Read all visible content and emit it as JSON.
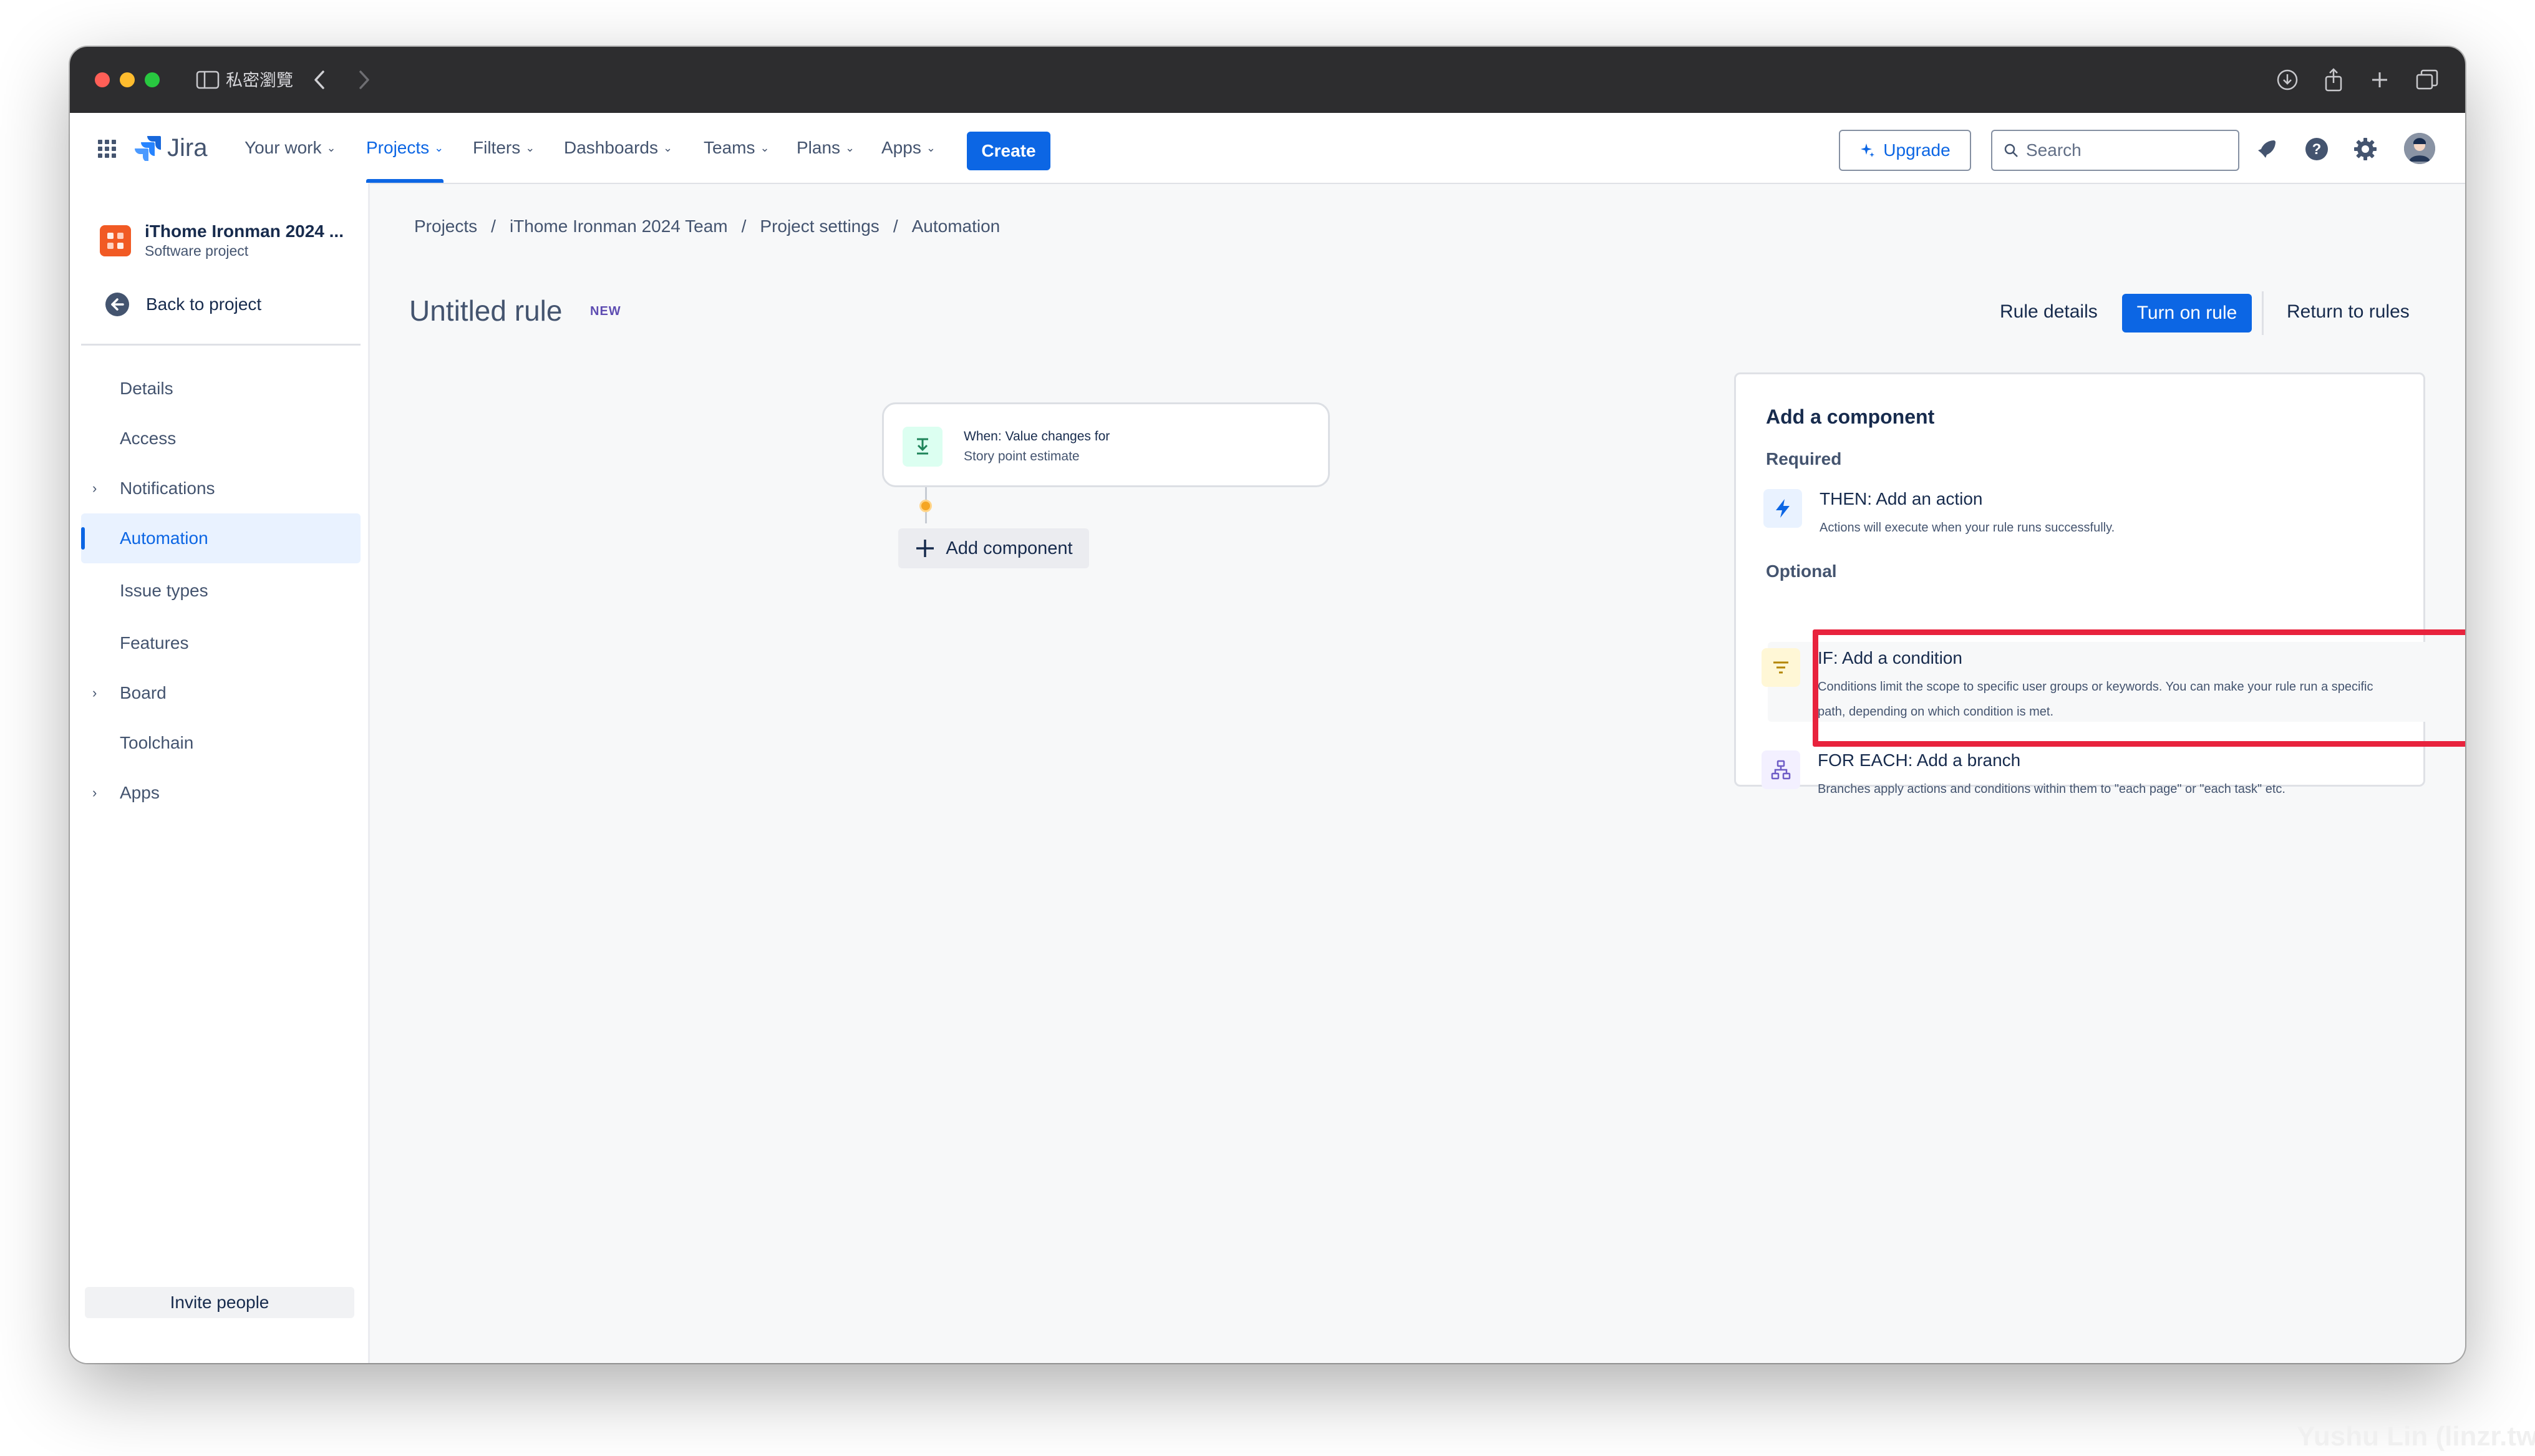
{
  "browser": {
    "tab_label": "私密瀏覽"
  },
  "header": {
    "logo_text": "Jira",
    "nav": [
      {
        "label": "Your work"
      },
      {
        "label": "Projects"
      },
      {
        "label": "Filters"
      },
      {
        "label": "Dashboards"
      },
      {
        "label": "Teams"
      },
      {
        "label": "Plans"
      },
      {
        "label": "Apps"
      }
    ],
    "create_label": "Create",
    "upgrade_label": "Upgrade",
    "search_placeholder": "Search"
  },
  "sidebar": {
    "project_name": "iThome Ironman 2024 ...",
    "project_type": "Software project",
    "back_label": "Back to project",
    "items": [
      {
        "label": "Details"
      },
      {
        "label": "Access"
      },
      {
        "label": "Notifications"
      },
      {
        "label": "Automation"
      },
      {
        "label": "Issue types"
      },
      {
        "label": "Features"
      },
      {
        "label": "Board"
      },
      {
        "label": "Toolchain"
      },
      {
        "label": "Apps"
      }
    ],
    "invite_label": "Invite people"
  },
  "breadcrumb": {
    "items": [
      "Projects",
      "iThome Ironman 2024 Team",
      "Project settings",
      "Automation"
    ],
    "separator": "/"
  },
  "rule": {
    "title": "Untitled rule",
    "badge": "NEW",
    "rule_details_label": "Rule details",
    "turn_on_label": "Turn on rule",
    "return_label": "Return to rules"
  },
  "trigger": {
    "title": "When: Value changes for",
    "subtitle": "Story point estimate"
  },
  "add_component_label": "Add component",
  "panel": {
    "title": "Add a component",
    "required_label": "Required",
    "optional_label": "Optional",
    "options": [
      {
        "title": "THEN: Add an action",
        "desc": "Actions will execute when your rule runs successfully."
      },
      {
        "title": "IF: Add a condition",
        "desc": "Conditions limit the scope to specific user groups or keywords. You can make your rule run a specific path, depending on which condition is met."
      },
      {
        "title": "FOR EACH: Add a branch",
        "desc": "Branches apply actions and conditions within them to \"each page\" or \"each task\" etc."
      }
    ]
  },
  "watermark": "Yushu Lin (linzr.tw)",
  "colors": {
    "accent": "#0c66e4",
    "highlight": "#e8233d"
  }
}
